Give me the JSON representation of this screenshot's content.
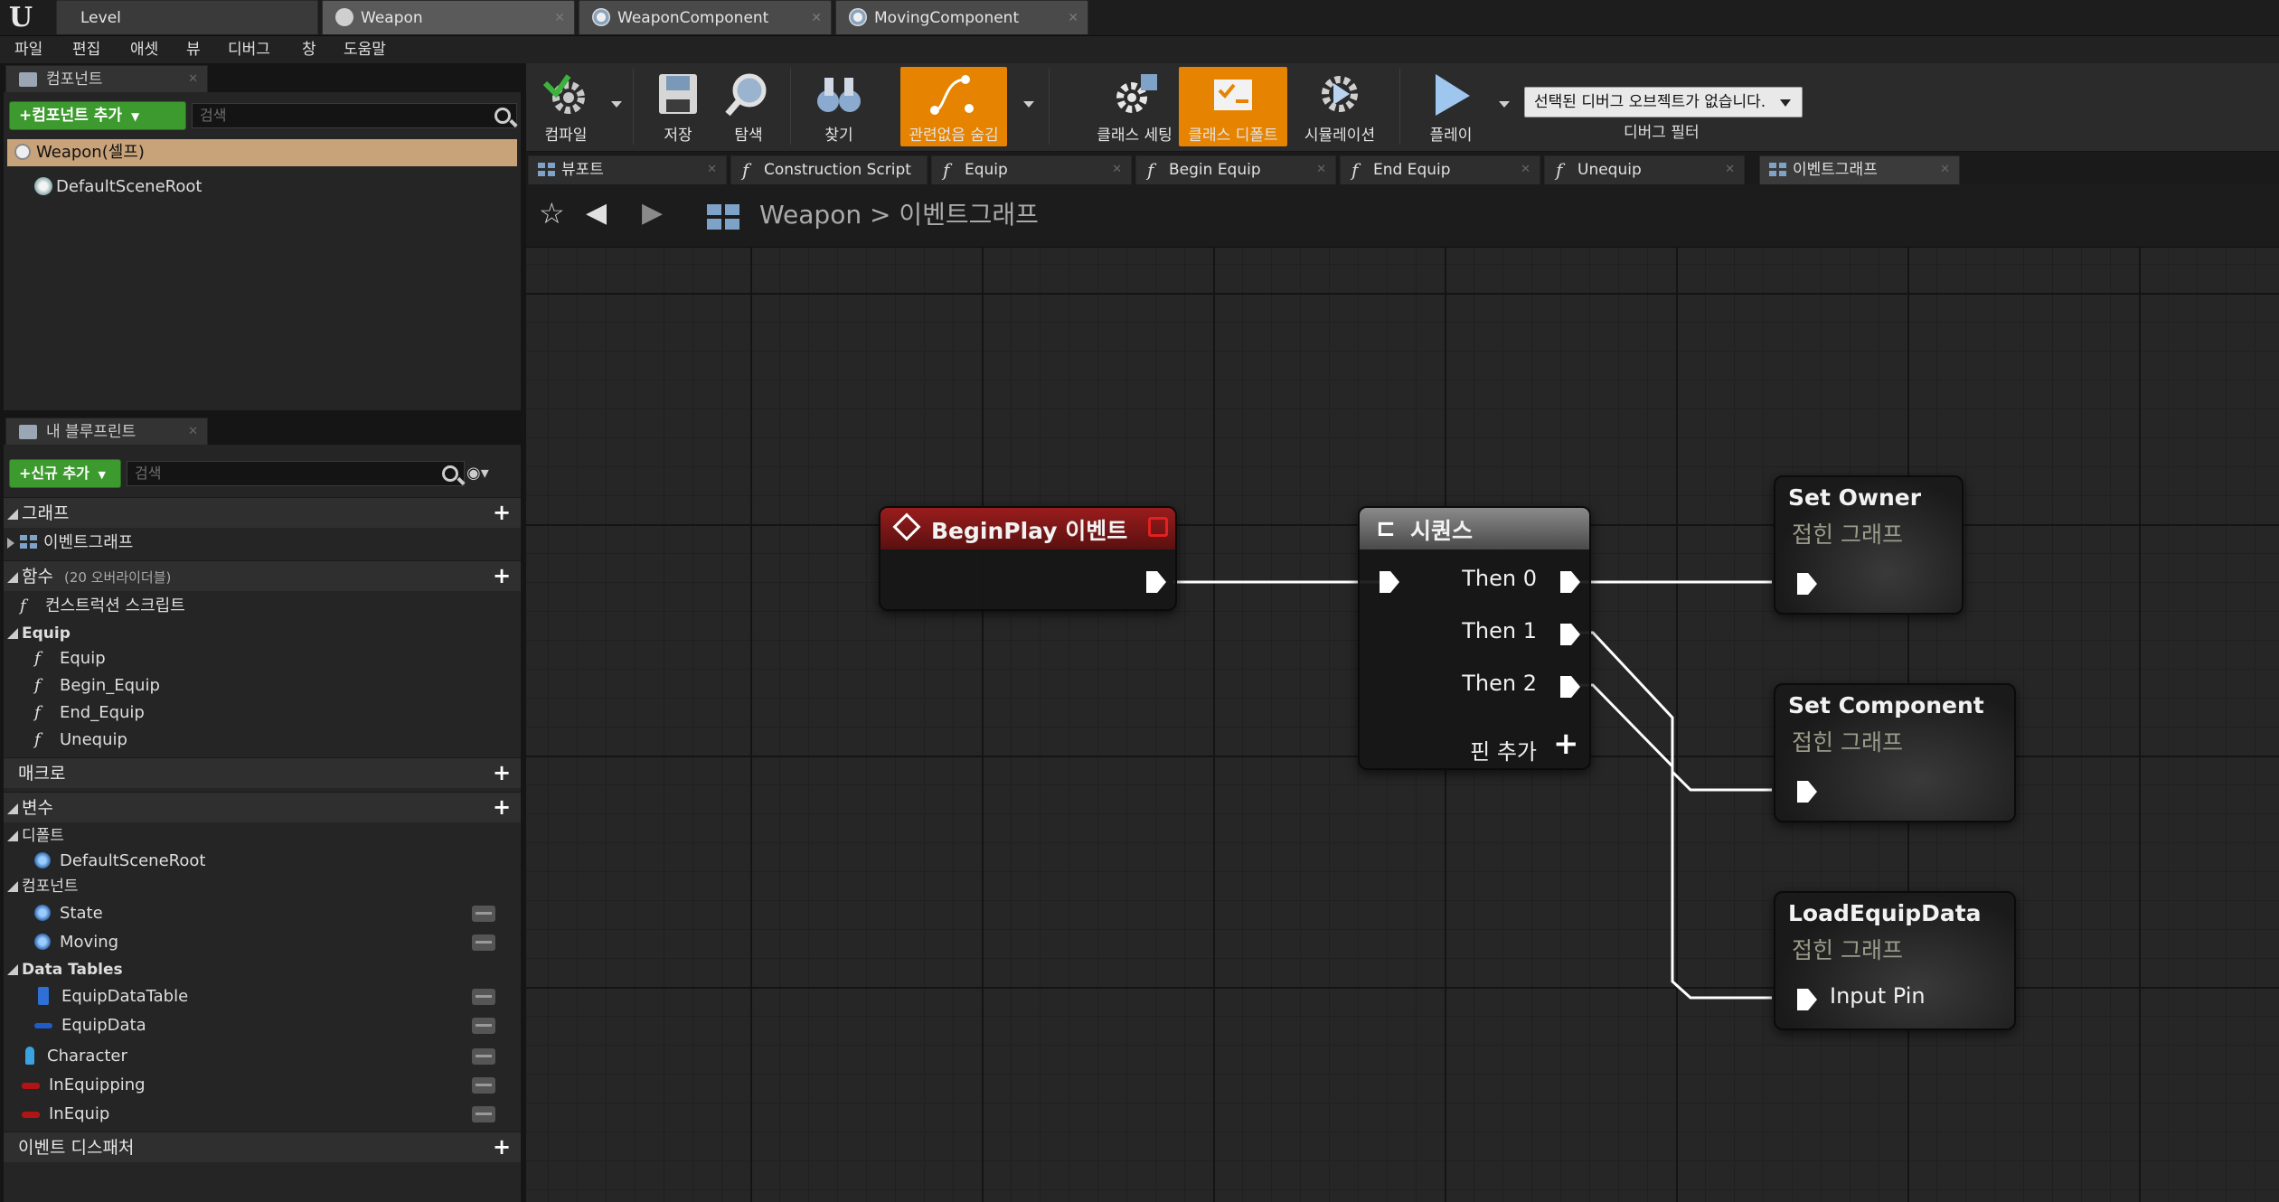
{
  "title_tabs": [
    {
      "label": "Level"
    },
    {
      "label": "Weapon"
    },
    {
      "label": "WeaponComponent"
    },
    {
      "label": "MovingComponent"
    }
  ],
  "menu": [
    "파일",
    "편집",
    "애셋",
    "뷰",
    "디버그",
    "창",
    "도움말"
  ],
  "components_panel": {
    "tab_label": "컴포넌트",
    "add_button": "+컴포넌트 추가",
    "search_placeholder": "검색",
    "self_item": "Weapon(셀프)",
    "root_item": "DefaultSceneRoot"
  },
  "blueprint_panel": {
    "tab_label": "내 블루프린트",
    "add_button": "+신규 추가",
    "search_placeholder": "검색",
    "graph_header": "그래프",
    "event_graph": "이벤트그래프",
    "functions_header": "함수",
    "functions_override": "(20 오버라이더블)",
    "construction_script": "컨스트럭션 스크립트",
    "equip_category": "Equip",
    "functions": [
      "Equip",
      "Begin_Equip",
      "End_Equip",
      "Unequip"
    ],
    "macros_header": "매크로",
    "variables_header": "변수",
    "default_category": "디폴트",
    "default_vars": [
      "DefaultSceneRoot"
    ],
    "component_category": "컴포넌트",
    "component_vars": [
      "State",
      "Moving"
    ],
    "datatables_category": "Data Tables",
    "datatable_vars": [
      "EquipDataTable",
      "EquipData"
    ],
    "other_vars": [
      "Character",
      "InEquipping",
      "InEquip"
    ],
    "dispatchers_header": "이벤트 디스패처"
  },
  "toolbar": {
    "compile": "컴파일",
    "save": "저장",
    "browse": "탐색",
    "find": "찾기",
    "hide_unrelated": "관련없음 숨김",
    "class_settings": "클래스 세팅",
    "class_defaults": "클래스 디폴트",
    "simulation": "시뮬레이션",
    "play": "플레이",
    "debug_select": "선택된 디버그 오브젝트가 없습니다.",
    "debug_filter": "디버그 필터"
  },
  "graph_tabs": [
    "뷰포트",
    "Construction Script",
    "Equip",
    "Begin Equip",
    "End Equip",
    "Unequip",
    "이벤트그래프"
  ],
  "breadcrumb": {
    "root": "Weapon",
    "sep": ">",
    "current": "이벤트그래프"
  },
  "nodes": {
    "begin_play": {
      "title": "BeginPlay 이벤트"
    },
    "sequence": {
      "title": "시퀀스",
      "pins": [
        "Then 0",
        "Then 1",
        "Then 2"
      ],
      "add_pin": "핀 추가"
    },
    "set_owner": {
      "title": "Set Owner",
      "subtitle": "접힌 그래프"
    },
    "set_component": {
      "title": "Set Component",
      "subtitle": "접힌 그래프"
    },
    "load_equip": {
      "title": "LoadEquipData",
      "subtitle": "접힌 그래프",
      "pin": "Input Pin"
    }
  },
  "colors": {
    "accent_orange": "#e68300",
    "add_green": "#3c9a2e",
    "event_red": "#8a1a1a"
  }
}
